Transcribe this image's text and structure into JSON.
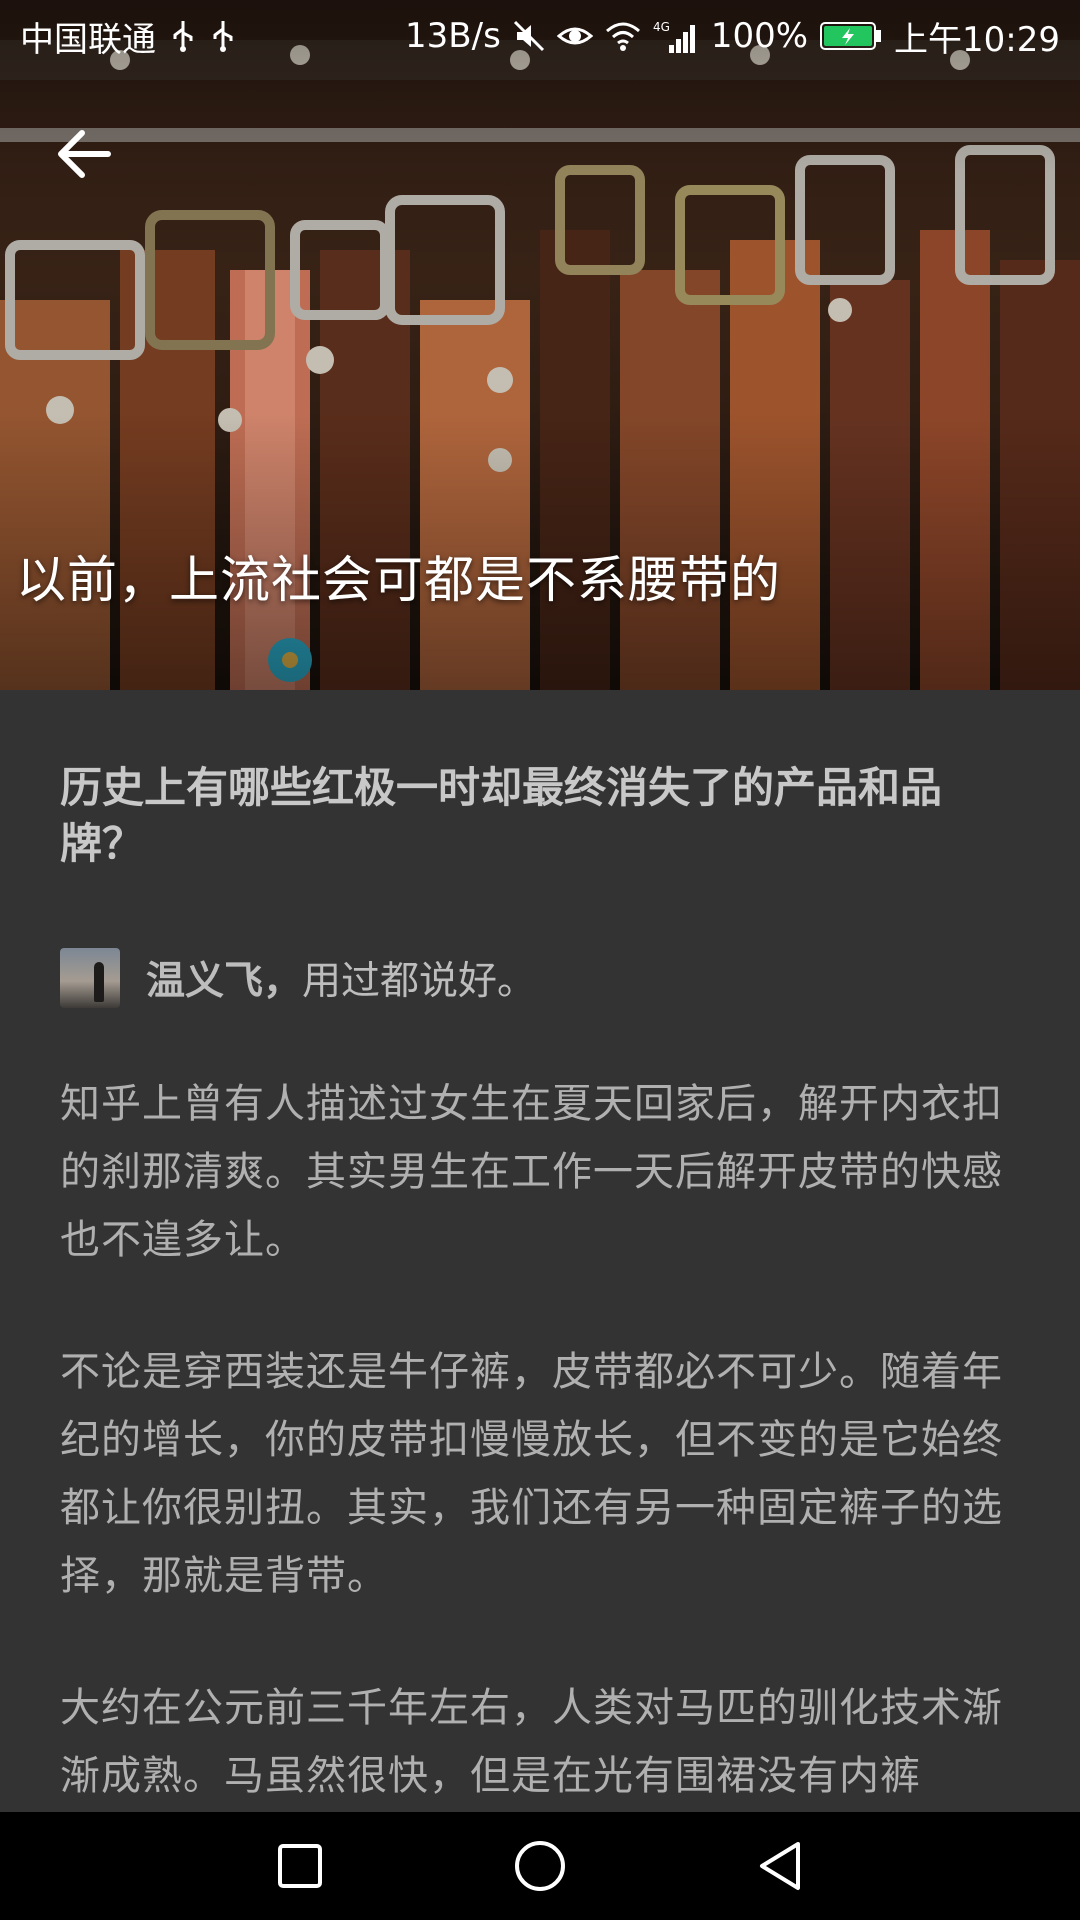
{
  "status_bar": {
    "carrier": "中国联通",
    "net_speed": "13B/s",
    "battery_percent": "100%",
    "time": "上午10:29",
    "icons": [
      "usb-icon",
      "usb-icon",
      "mute-icon",
      "eye-comfort-icon",
      "wifi-icon",
      "signal-4g-icon",
      "battery-icon"
    ],
    "battery_color": "#22c55e"
  },
  "header": {
    "back_icon": "arrow-left-icon",
    "title": "以前，上流社会可都是不系腰带的"
  },
  "article": {
    "question": "历史上有哪些红极一时却最终消失了的产品和品牌？",
    "author": {
      "name": "温义飞，",
      "bio": "用过都说好。"
    },
    "paragraphs": [
      "知乎上曾有人描述过女生在夏天回家后，解开内衣扣的刹那清爽。其实男生在工作一天后解开皮带的快感也不遑多让。",
      "不论是穿西装还是牛仔裤，皮带都必不可少。随着年纪的增长，你的皮带扣慢慢放长，但不变的是它始终都让你很别扭。其实，我们还有另一种固定裤子的选择，那就是背带。",
      "大约在公元前三千年左右，人类对马匹的驯化技术渐渐成熟。马虽然很快，但是在光有围裙没有内裤"
    ]
  },
  "nav_bar": {
    "icons": [
      "recents-square-icon",
      "home-circle-icon",
      "back-triangle-icon"
    ]
  }
}
